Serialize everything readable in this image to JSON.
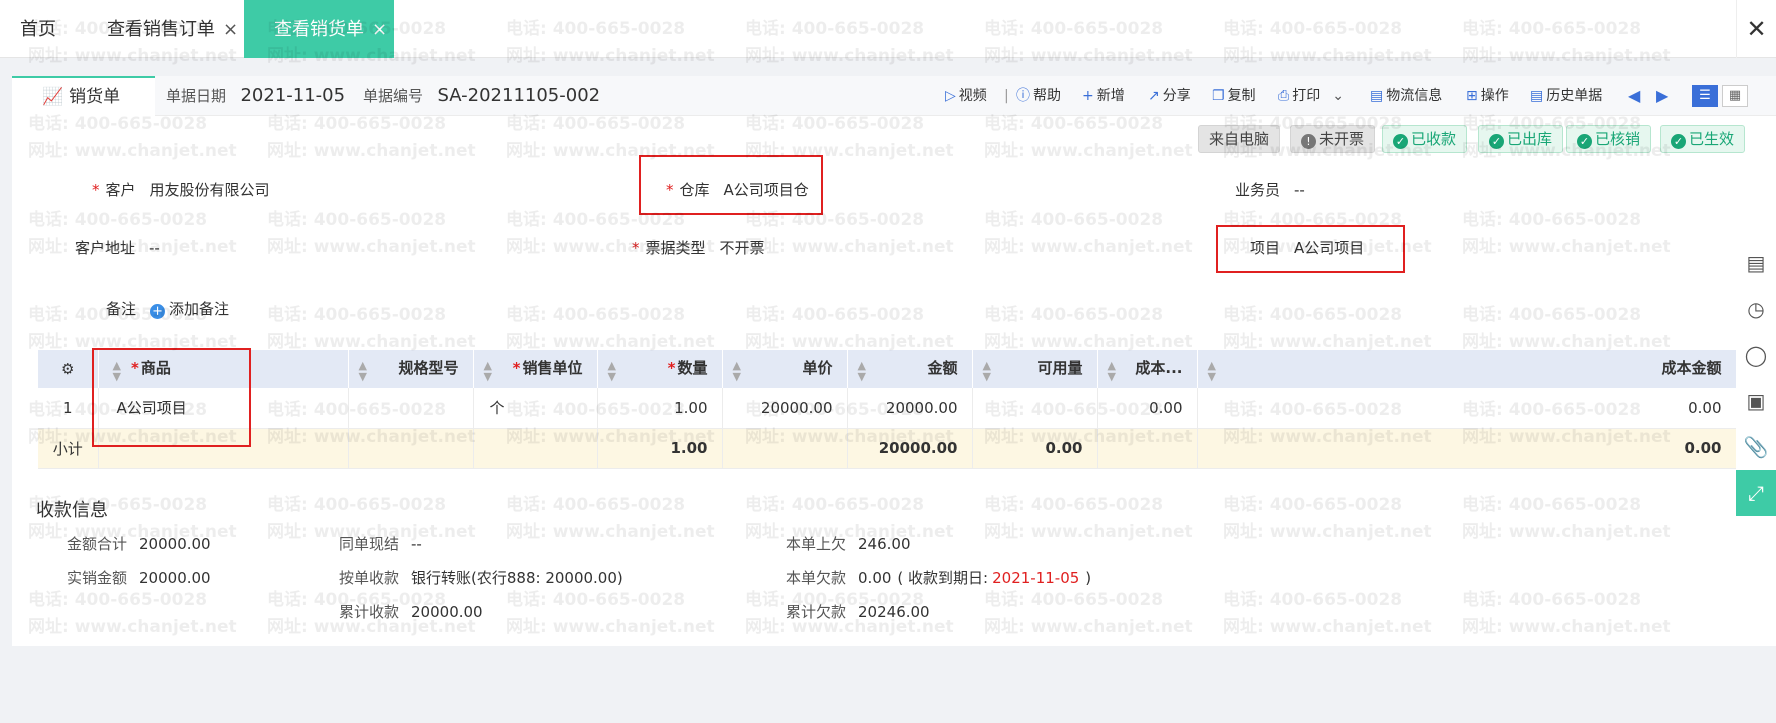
{
  "tabs": {
    "home": "首页",
    "order": "查看销售订单",
    "delivery": "查看销货单",
    "close": "×"
  },
  "window": {
    "close": "✕"
  },
  "doc": {
    "title": "销货单",
    "date_label": "单据日期",
    "date": "2021-11-05",
    "number_label": "单据编号",
    "number": "SA-20211105-002"
  },
  "toolbar": {
    "video": "视频",
    "sep": "|",
    "help": "帮助",
    "add": "新增",
    "share": "分享",
    "copy": "复制",
    "print": "打印",
    "logistics": "物流信息",
    "ops": "操作",
    "history": "历史单据"
  },
  "badges": {
    "source": "来自电脑",
    "invoice": "未开票",
    "received": "已收款",
    "outbound": "已出库",
    "verified": "已核销",
    "effective": "已生效"
  },
  "form": {
    "customer_label": "客户",
    "customer": "用友股份有限公司",
    "warehouse_label": "仓库",
    "warehouse": "A公司项目仓",
    "salesman_label": "业务员",
    "salesman": "--",
    "address_label": "客户地址",
    "address": "--",
    "invoice_type_label": "票据类型",
    "invoice_type": "不开票",
    "project_label": "项目",
    "project": "A公司项目",
    "remark_label": "备注",
    "add_remark": "添加备注"
  },
  "table": {
    "headers": {
      "product": "商品",
      "spec": "规格型号",
      "unit": "销售单位",
      "qty": "数量",
      "price": "单价",
      "amount": "金额",
      "available": "可用量",
      "cost": "成本...",
      "cost_amount": "成本金额"
    },
    "rows": [
      {
        "no": "1",
        "product": "A公司项目",
        "spec": "",
        "unit": "个",
        "qty": "1.00",
        "price": "20000.00",
        "amount": "20000.00",
        "available": "",
        "cost": "0.00",
        "cost_amount": "0.00"
      }
    ],
    "subtotal": {
      "label": "小计",
      "qty": "1.00",
      "amount": "20000.00",
      "available": "0.00",
      "cost_amount": "0.00"
    }
  },
  "payment": {
    "title": "收款信息",
    "total_label": "金额合计",
    "total": "20000.00",
    "actual_label": "实销金额",
    "actual": "20000.00",
    "cash_label": "同单现结",
    "cash": "--",
    "by_doc_label": "按单收款",
    "by_doc": "银行转账(农行888: 20000.00)",
    "cum_received_label": "累计收款",
    "cum_received": "20000.00",
    "prev_owed_label": "本单上欠",
    "prev_owed": "246.00",
    "owed_label": "本单欠款",
    "owed": "0.00",
    "due_prefix": "( 收款到期日:",
    "due_date": "2021-11-05",
    "due_suffix": ")",
    "cum_owed_label": "累计欠款",
    "cum_owed": "20246.00"
  },
  "watermark": {
    "phone": "电话: 400-665-0028",
    "site": "网址: www.chanjet.net"
  },
  "colors": {
    "accent": "#3ecba6",
    "highlight_border": "#e02020",
    "link": "#3a8ee6"
  }
}
